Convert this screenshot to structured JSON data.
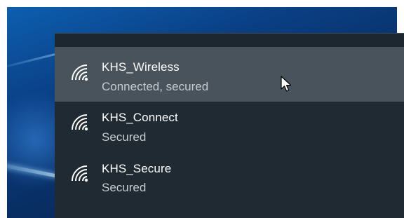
{
  "networks": [
    {
      "name": "KHS_Wireless",
      "status": "Connected, secured",
      "selected": true,
      "icon": "wifi-icon"
    },
    {
      "name": "KHS_Connect",
      "status": "Secured",
      "selected": false,
      "icon": "wifi-icon"
    },
    {
      "name": "KHS_Secure",
      "status": "Secured",
      "selected": false,
      "icon": "wifi-icon"
    }
  ],
  "colors": {
    "flyout_background": "#1f2a33",
    "selected_background": "#48535c",
    "primary_text": "#ffffff",
    "secondary_text": "#c5cbd0",
    "desktop_accent": "#0a3f84"
  },
  "cursor": {
    "icon": "mouse-pointer-icon"
  }
}
